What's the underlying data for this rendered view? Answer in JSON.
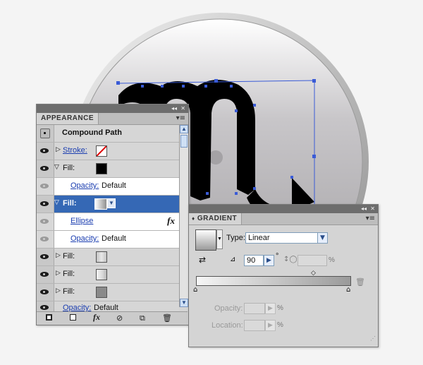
{
  "appearance": {
    "tab_label": "APPEARANCE",
    "collapse_icon": "◂◂",
    "close_icon": "✕",
    "menu_icon": "▾≡",
    "rows": {
      "compound": {
        "label": "Compound Path"
      },
      "stroke": {
        "label": "Stroke:"
      },
      "fill_black": {
        "label": "Fill:"
      },
      "opacity_1": {
        "label": "Opacity:",
        "value": "Default"
      },
      "fill_selected": {
        "label": "Fill:"
      },
      "ellipse": {
        "label": "Ellipse",
        "fx": "fx"
      },
      "opacity_2": {
        "label": "Opacity:",
        "value": "Default"
      },
      "fill_a": {
        "label": "Fill:"
      },
      "fill_b": {
        "label": "Fill:"
      },
      "fill_c": {
        "label": "Fill:"
      },
      "opacity_3": {
        "label": "Opacity:",
        "value": "Default"
      }
    },
    "footer": {
      "fx_label": "fx"
    }
  },
  "gradient": {
    "tab_label": "GRADIENT",
    "type_label": "Type:",
    "type_value": "Linear",
    "angle_value": "90",
    "angle_unit": "°",
    "aspect_unit": "%",
    "opacity_label": "Opacity:",
    "opacity_unit": "%",
    "location_label": "Location:",
    "location_unit": "%"
  },
  "colors": {
    "selection_blue": "#3568b5",
    "bounding_box": "#3a5bd6",
    "glyph": "#000000"
  }
}
